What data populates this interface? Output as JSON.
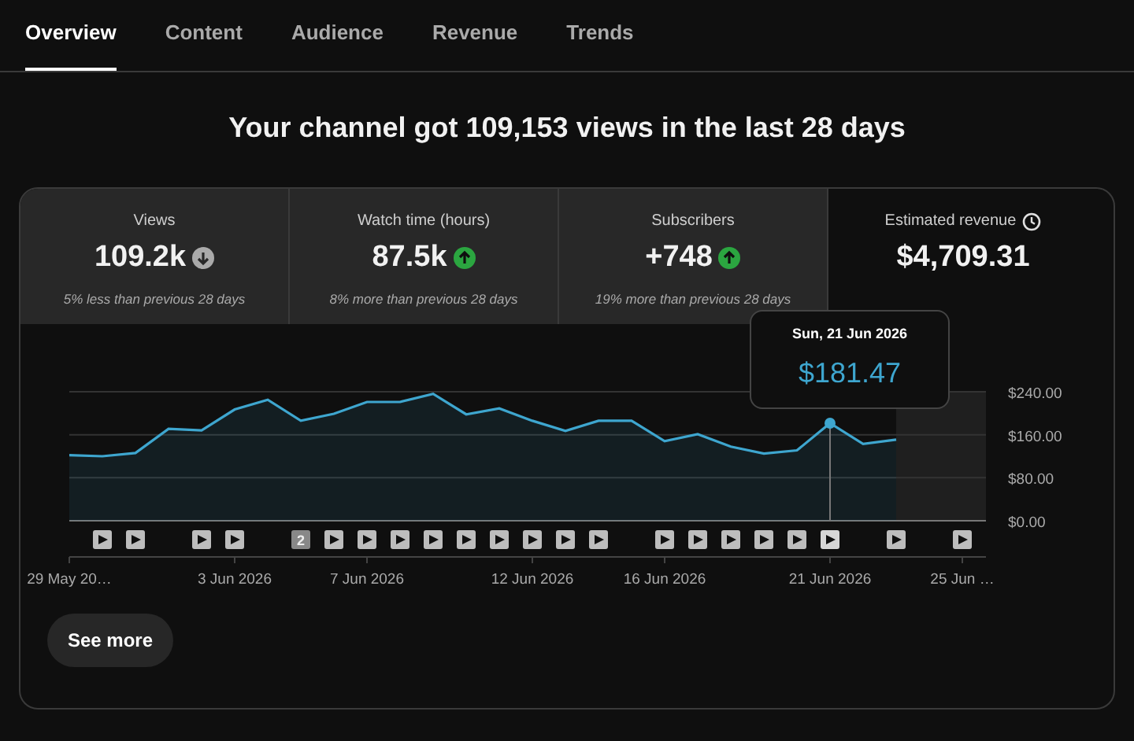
{
  "tabs": [
    {
      "label": "Overview",
      "selected": true
    },
    {
      "label": "Content",
      "selected": false
    },
    {
      "label": "Audience",
      "selected": false
    },
    {
      "label": "Revenue",
      "selected": false
    },
    {
      "label": "Trends",
      "selected": false
    }
  ],
  "headline": "Your channel got 109,153 views in the last 28 days",
  "metrics": [
    {
      "label": "Views",
      "value": "109.2k",
      "kind": "down",
      "note": "5% less than previous 28 days",
      "selected": false
    },
    {
      "label": "Watch time (hours)",
      "value": "87.5k",
      "kind": "up",
      "note": "8% more than previous 28 days",
      "selected": false
    },
    {
      "label": "Subscribers",
      "value": "+748",
      "kind": "up",
      "note": "19% more than previous 28 days",
      "selected": false
    },
    {
      "label": "Estimated revenue",
      "value": "$4,709.31",
      "kind": "realtime",
      "selected": true
    }
  ],
  "chart": {
    "chart_data": {
      "type": "area",
      "categories": [
        "29 May 20…",
        null,
        null,
        null,
        null,
        "3 Jun 2026",
        null,
        null,
        null,
        "7 Jun 2026",
        null,
        null,
        null,
        null,
        "12 Jun 2026",
        null,
        null,
        null,
        "16 Jun 2026",
        null,
        null,
        null,
        null,
        "21 Jun 2026",
        null,
        null,
        null,
        "25 Jun …"
      ],
      "series": [
        {
          "color": "#3ea6cf",
          "values": [
            122,
            120,
            126,
            171,
            168,
            207,
            225,
            186,
            199,
            221,
            221,
            236,
            198,
            209,
            186,
            167,
            186,
            186,
            148,
            161,
            138,
            125,
            131,
            181.47,
            143,
            151,
            null,
            null
          ]
        }
      ],
      "ylim": [
        0,
        240
      ],
      "yticks": [
        {
          "value": 0,
          "label": "$0.00"
        },
        {
          "value": 80,
          "label": "$80.00"
        },
        {
          "value": 160,
          "label": "$160.00"
        },
        {
          "value": 240,
          "label": "$240.00"
        }
      ],
      "annotations": [
        "$181.47"
      ]
    },
    "tooltip_date": "Sun, 21 Jun 2026",
    "markers": [
      {
        "kind": "none"
      },
      {
        "kind": "video",
        "hovered": false
      },
      {
        "kind": "video",
        "hovered": false
      },
      {
        "kind": "none"
      },
      {
        "kind": "video",
        "hovered": false
      },
      {
        "kind": "video",
        "hovered": false
      },
      {
        "kind": "none"
      },
      {
        "kind": "count",
        "text": "2",
        "hovered": false
      },
      {
        "kind": "video",
        "hovered": false
      },
      {
        "kind": "video",
        "hovered": false
      },
      {
        "kind": "video",
        "hovered": false
      },
      {
        "kind": "video",
        "hovered": false
      },
      {
        "kind": "video",
        "hovered": false
      },
      {
        "kind": "video",
        "hovered": false
      },
      {
        "kind": "video",
        "hovered": false
      },
      {
        "kind": "video",
        "hovered": false
      },
      {
        "kind": "video",
        "hovered": false
      },
      {
        "kind": "none"
      },
      {
        "kind": "video",
        "hovered": false
      },
      {
        "kind": "video",
        "hovered": false
      },
      {
        "kind": "video",
        "hovered": false
      },
      {
        "kind": "video",
        "hovered": false
      },
      {
        "kind": "video",
        "hovered": false
      },
      {
        "kind": "video",
        "hovered": true
      },
      {
        "kind": "none"
      },
      {
        "kind": "video",
        "hovered": false
      },
      {
        "kind": "none"
      },
      {
        "kind": "video",
        "hovered": false
      }
    ]
  },
  "see_more": "See more"
}
